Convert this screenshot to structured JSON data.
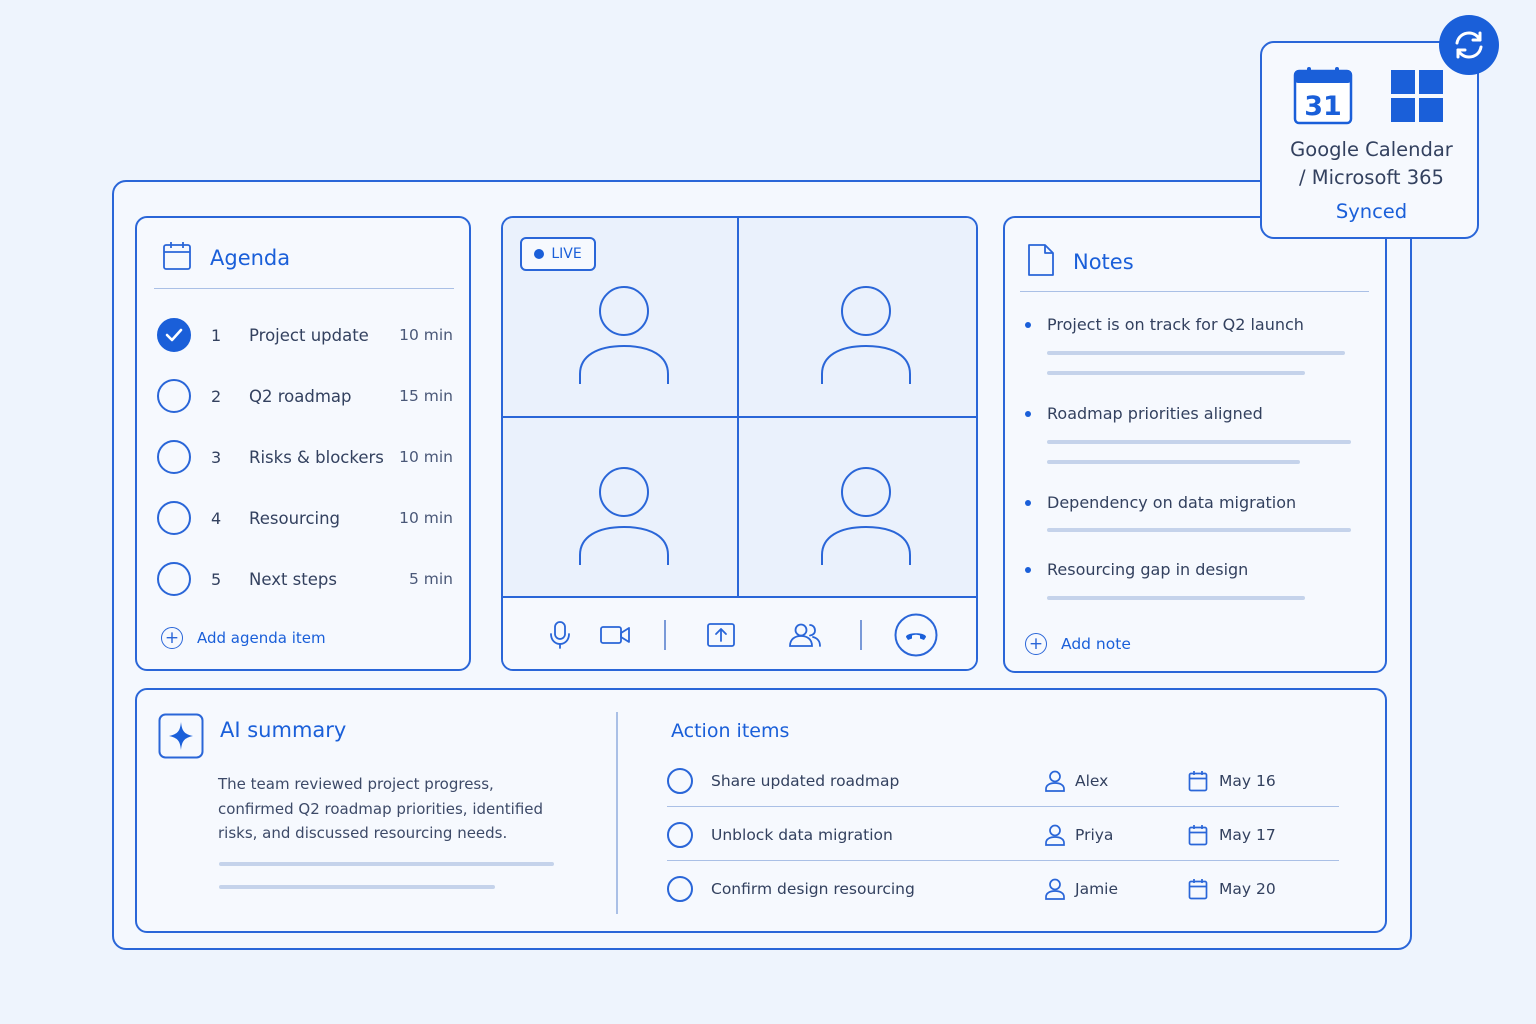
{
  "agenda": {
    "title": "Agenda",
    "items": [
      {
        "num": "1",
        "label": "Project update",
        "duration": "10 min",
        "done": true
      },
      {
        "num": "2",
        "label": "Q2 roadmap",
        "duration": "15 min",
        "done": false
      },
      {
        "num": "3",
        "label": "Risks & blockers",
        "duration": "10 min",
        "done": false
      },
      {
        "num": "4",
        "label": "Resourcing",
        "duration": "10 min",
        "done": false
      },
      {
        "num": "5",
        "label": "Next steps",
        "duration": "5 min",
        "done": false
      }
    ],
    "add_label": "Add agenda item"
  },
  "video": {
    "live_label": "LIVE",
    "controls": [
      "mic-icon",
      "camera-icon",
      "share-screen-icon",
      "participants-icon",
      "end-call-icon"
    ]
  },
  "notes": {
    "title": "Notes",
    "items": [
      "Project is on track for Q2 launch",
      "Roadmap priorities aligned",
      "Dependency on data migration",
      "Resourcing gap in design"
    ],
    "add_label": "Add note"
  },
  "sync": {
    "calendar_day": "31",
    "line1": "Google Calendar",
    "line2": "/ Microsoft 365",
    "status": "Synced"
  },
  "summary": {
    "title": "AI summary",
    "text": "The team reviewed project progress, confirmed Q2 roadmap priorities, identified risks, and discussed resourcing needs."
  },
  "actions": {
    "title": "Action items",
    "items": [
      {
        "label": "Share updated roadmap",
        "owner": "Alex",
        "due": "May 16"
      },
      {
        "label": "Unblock data migration",
        "owner": "Priya",
        "due": "May 17"
      },
      {
        "label": "Confirm design resourcing",
        "owner": "Jamie",
        "due": "May 20"
      }
    ]
  },
  "colors": {
    "accent": "#1a5fd9",
    "background": "#eef4fd",
    "panel": "#f6f9fe"
  }
}
